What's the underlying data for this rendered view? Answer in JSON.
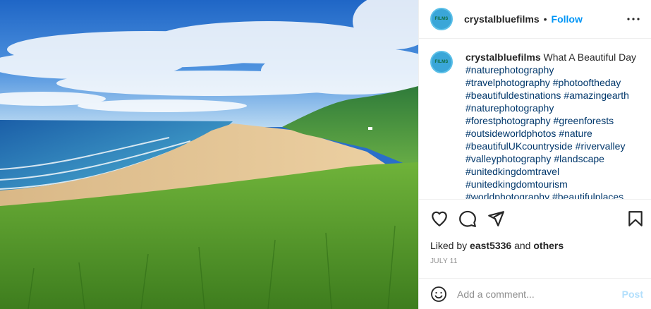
{
  "post": {
    "username": "crystalbluefilms",
    "separator": "•",
    "follow_label": "Follow",
    "avatar_text": "FILMS",
    "more_icon": "more-options-icon"
  },
  "caption": {
    "username": "crystalbluefilms",
    "text": " What A Beautiful Day",
    "hashtags": [
      "#naturephotography",
      "#travelphotography",
      "#photooftheday",
      "#beautifuldestinations",
      "#amazingearth",
      "#naturephotography",
      "#forestphotography",
      "#greenforests",
      "#outsideworldphotos",
      "#nature",
      "#beautifulUKcountryside",
      "#rivervalley",
      "#valleyphotography",
      "#landscape",
      "#unitedkingdomtravel",
      "#unitedkingdomtourism",
      "#worldphotography",
      "#beautifulplaces"
    ]
  },
  "actions": {
    "icons": [
      "heart-icon",
      "comment-icon",
      "share-icon",
      "bookmark-icon"
    ],
    "liked_by_prefix": "Liked by",
    "liked_by_user": "east5336",
    "liked_by_and": "and",
    "liked_by_others": "others",
    "date": "JULY 11"
  },
  "comment": {
    "placeholder": "Add a comment...",
    "post_label": "Post",
    "emoji_icon": "emoji-icon"
  },
  "colors": {
    "link_blue": "#0095f6",
    "hashtag": "#00376b",
    "muted": "#8e8e8e",
    "post_disabled": "#b2dffc"
  }
}
